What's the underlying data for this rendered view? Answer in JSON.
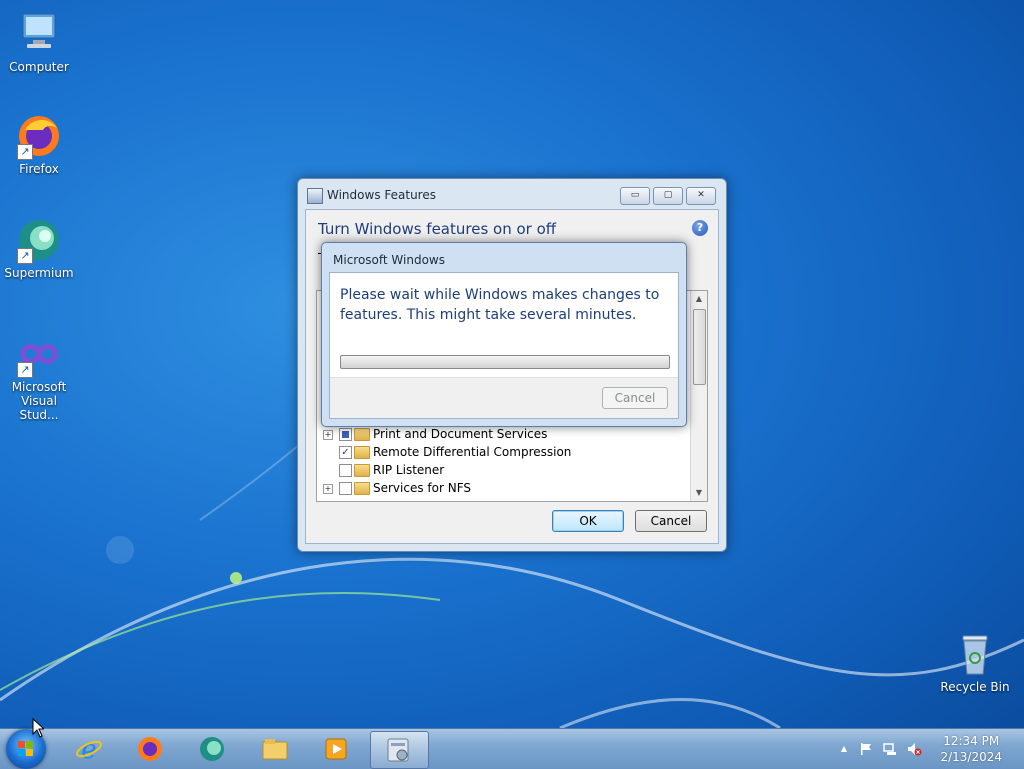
{
  "desktop": {
    "icons": [
      {
        "label": "Computer",
        "icon": "computer-icon"
      },
      {
        "label": "Firefox",
        "icon": "firefox-icon"
      },
      {
        "label": "Supermium",
        "icon": "supermium-icon"
      },
      {
        "label": "Microsoft Visual Stud...",
        "icon": "visual-studio-icon"
      },
      {
        "label": "Recycle Bin",
        "icon": "recycle-bin-icon"
      }
    ]
  },
  "features_window": {
    "title": "Windows Features",
    "heading": "Turn Windows features on or off",
    "partial_text": "T",
    "help_glyph": "?",
    "caption": {
      "minimize": "▭",
      "maximize": "▢",
      "close": "✕"
    },
    "items": [
      {
        "label": "Print and Document Services",
        "state": "partial",
        "expandable": true
      },
      {
        "label": "Remote Differential Compression",
        "state": "checked",
        "expandable": false
      },
      {
        "label": "RIP Listener",
        "state": "unchecked",
        "expandable": false
      },
      {
        "label": "Services for NFS",
        "state": "unchecked",
        "expandable": true
      }
    ],
    "ok_label": "OK",
    "cancel_label": "Cancel"
  },
  "progress_dialog": {
    "title": "Microsoft Windows",
    "message": "Please wait while Windows makes changes to features. This might take several minutes.",
    "progress": 0,
    "cancel_label": "Cancel"
  },
  "taskbar": {
    "pinned": [
      "internet-explorer-icon",
      "firefox-icon",
      "supermium-icon",
      "file-explorer-icon",
      "media-player-icon",
      "windows-features-icon"
    ],
    "active_index": 5,
    "tray": {
      "show_hidden": "▲",
      "time": "12:34 PM",
      "date": "2/13/2024"
    }
  }
}
